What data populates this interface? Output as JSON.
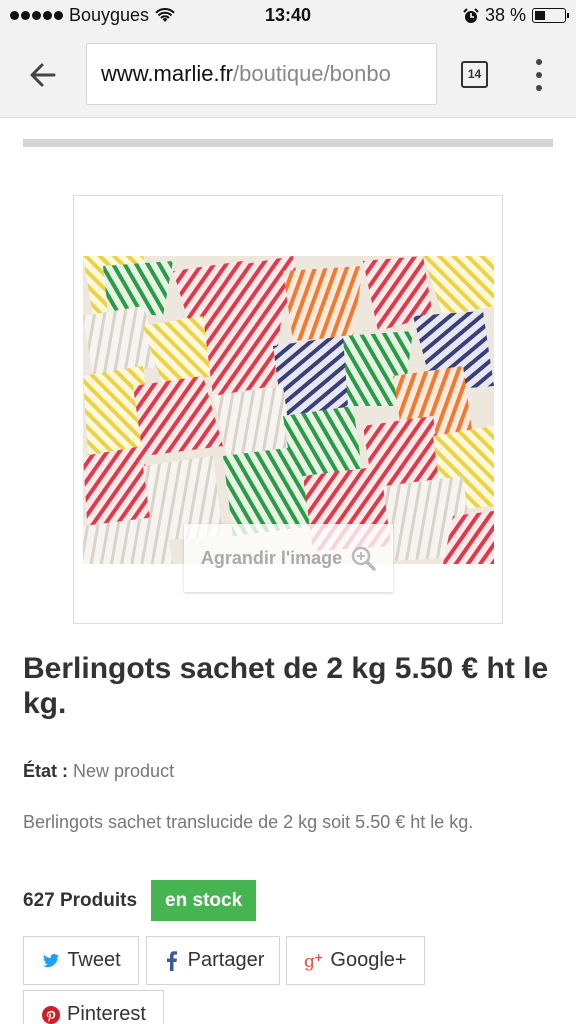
{
  "status_bar": {
    "carrier": "Bouygues",
    "time": "13:40",
    "battery": "38 %",
    "battery_level": 0.38
  },
  "browser": {
    "url_host": "www.marlie.fr",
    "url_path": "/boutique/bonbo",
    "tab_count": "14"
  },
  "product": {
    "zoom_label": "Agrandir l'image",
    "title": "Berlingots sachet de 2 kg 5.50 € ht le kg.",
    "condition_label": "État :",
    "condition_value": "New product",
    "description": "Berlingots sachet translucide de 2 kg soit 5.50 € ht le kg.",
    "stock_count": "627 Produits",
    "stock_badge": "en stock"
  },
  "share": {
    "tweet": "Tweet",
    "facebook": "Partager",
    "google": "Google+",
    "pinterest": "Pinterest"
  },
  "colors": {
    "stock_green": "#46b450",
    "twitter": "#1da1f2",
    "facebook": "#3b5998",
    "google": "#dd4b39",
    "pinterest": "#cb2027"
  }
}
